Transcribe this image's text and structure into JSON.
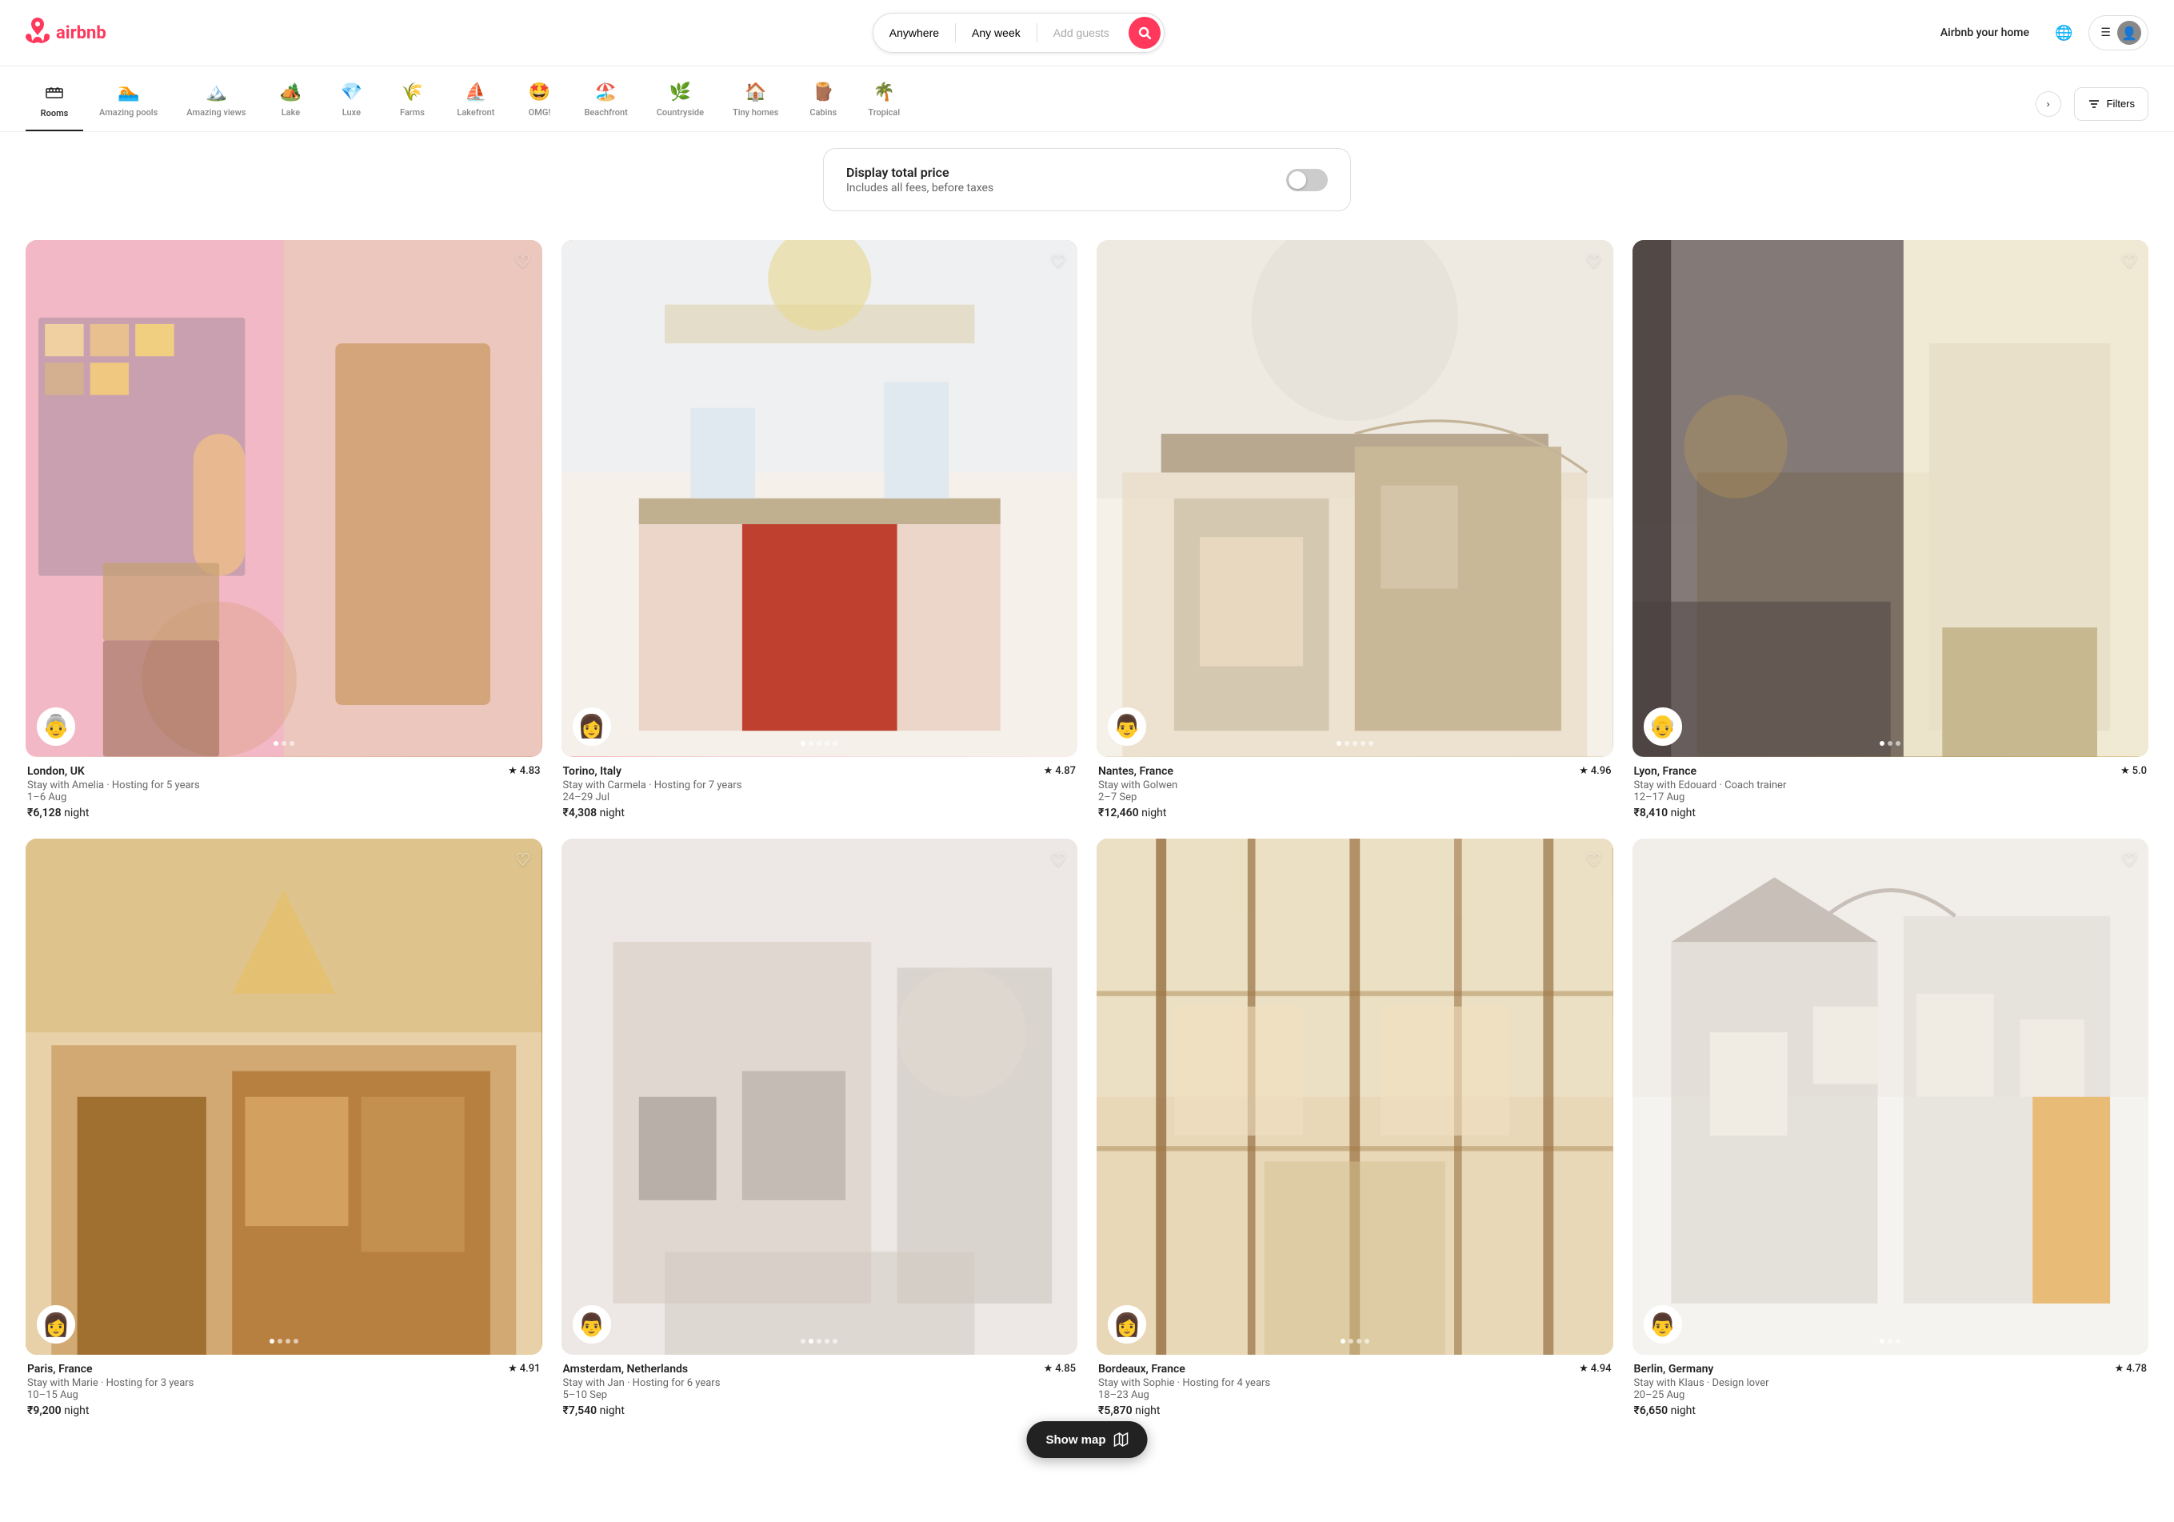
{
  "brand": {
    "name": "airbnb",
    "logo_symbol": "✦"
  },
  "header": {
    "search": {
      "location_placeholder": "Anywhere",
      "date_placeholder": "Any week",
      "guests_placeholder": "Add guests"
    },
    "host_link": "Airbnb your home",
    "globe_label": "Choose language",
    "menu_label": "Menu",
    "profile_label": "Profile"
  },
  "categories": [
    {
      "id": "rooms",
      "label": "Rooms",
      "icon": "🪑",
      "active": true
    },
    {
      "id": "amazing-pools",
      "label": "Amazing pools",
      "icon": "🏊"
    },
    {
      "id": "amazing-views",
      "label": "Amazing views",
      "icon": "🏔️"
    },
    {
      "id": "lake",
      "label": "Lake",
      "icon": "🏕️"
    },
    {
      "id": "luxe",
      "label": "Luxe",
      "icon": "💎"
    },
    {
      "id": "farms",
      "label": "Farms",
      "icon": "🌾"
    },
    {
      "id": "lakefront",
      "label": "Lakefront",
      "icon": "⛵"
    },
    {
      "id": "omg",
      "label": "OMG!",
      "icon": "🤩"
    },
    {
      "id": "beachfront",
      "label": "Beachfront",
      "icon": "🏖️"
    },
    {
      "id": "countryside",
      "label": "Countryside",
      "icon": "🌿"
    },
    {
      "id": "tiny-homes",
      "label": "Tiny homes",
      "icon": "🏠"
    },
    {
      "id": "cabins",
      "label": "Cabins",
      "icon": "🪵"
    },
    {
      "id": "tropical",
      "label": "Tropical",
      "icon": "🌴"
    }
  ],
  "nav_arrow_label": "›",
  "filters_label": "Filters",
  "price_banner": {
    "title": "Display total price",
    "subtitle": "Includes all fees, before taxes",
    "toggle_on": false
  },
  "listings": [
    {
      "id": 1,
      "location": "London, UK",
      "rating": "4.83",
      "description": "Stay with Amelia · Hosting for 5 years",
      "dates": "1–6 Aug",
      "price": "₹6,128",
      "price_unit": "night",
      "bg_class": "bg-pink",
      "dots": 3,
      "active_dot": 0,
      "host_emoji": "👵"
    },
    {
      "id": 2,
      "location": "Torino, Italy",
      "rating": "4.87",
      "description": "Stay with Carmela · Hosting for 7 years",
      "dates": "24–29 Jul",
      "price": "₹4,308",
      "price_unit": "night",
      "bg_class": "bg-red",
      "dots": 5,
      "active_dot": 0,
      "host_emoji": "👩"
    },
    {
      "id": 3,
      "location": "Nantes, France",
      "rating": "4.96",
      "description": "Stay with Golwen",
      "dates": "2–7 Sep",
      "price": "₹12,460",
      "price_unit": "night",
      "bg_class": "bg-cream",
      "dots": 5,
      "active_dot": 0,
      "host_emoji": "👨"
    },
    {
      "id": 4,
      "location": "Lyon, France",
      "rating": "5.0",
      "description": "Stay with Edouard · Coach trainer",
      "dates": "12–17 Aug",
      "price": "₹8,410",
      "price_unit": "night",
      "bg_class": "bg-dark",
      "dots": 3,
      "active_dot": 0,
      "host_emoji": "👴"
    },
    {
      "id": 5,
      "location": "Paris, France",
      "rating": "4.91",
      "description": "Stay with Marie · Hosting for 3 years",
      "dates": "10–15 Aug",
      "price": "₹9,200",
      "price_unit": "night",
      "bg_class": "bg-warm",
      "dots": 4,
      "active_dot": 0,
      "host_emoji": "👩"
    },
    {
      "id": 6,
      "location": "Amsterdam, Netherlands",
      "rating": "4.85",
      "description": "Stay with Jan · Hosting for 6 years",
      "dates": "5–10 Sep",
      "price": "₹7,540",
      "price_unit": "night",
      "bg_class": "bg-light",
      "dots": 5,
      "active_dot": 1,
      "host_emoji": "👨"
    },
    {
      "id": 7,
      "location": "Bordeaux, France",
      "rating": "4.94",
      "description": "Stay with Sophie · Hosting for 4 years",
      "dates": "18–23 Aug",
      "price": "₹5,870",
      "price_unit": "night",
      "bg_class": "bg-wood",
      "dots": 4,
      "active_dot": 0,
      "host_emoji": "👩"
    },
    {
      "id": 8,
      "location": "Berlin, Germany",
      "rating": "4.78",
      "description": "Stay with Klaus · Design lover",
      "dates": "20–25 Aug",
      "price": "₹6,650",
      "price_unit": "night",
      "bg_class": "bg-white-arch",
      "dots": 3,
      "active_dot": 0,
      "host_emoji": "👨"
    }
  ],
  "show_map": {
    "label": "Show map",
    "icon": "⊞"
  }
}
